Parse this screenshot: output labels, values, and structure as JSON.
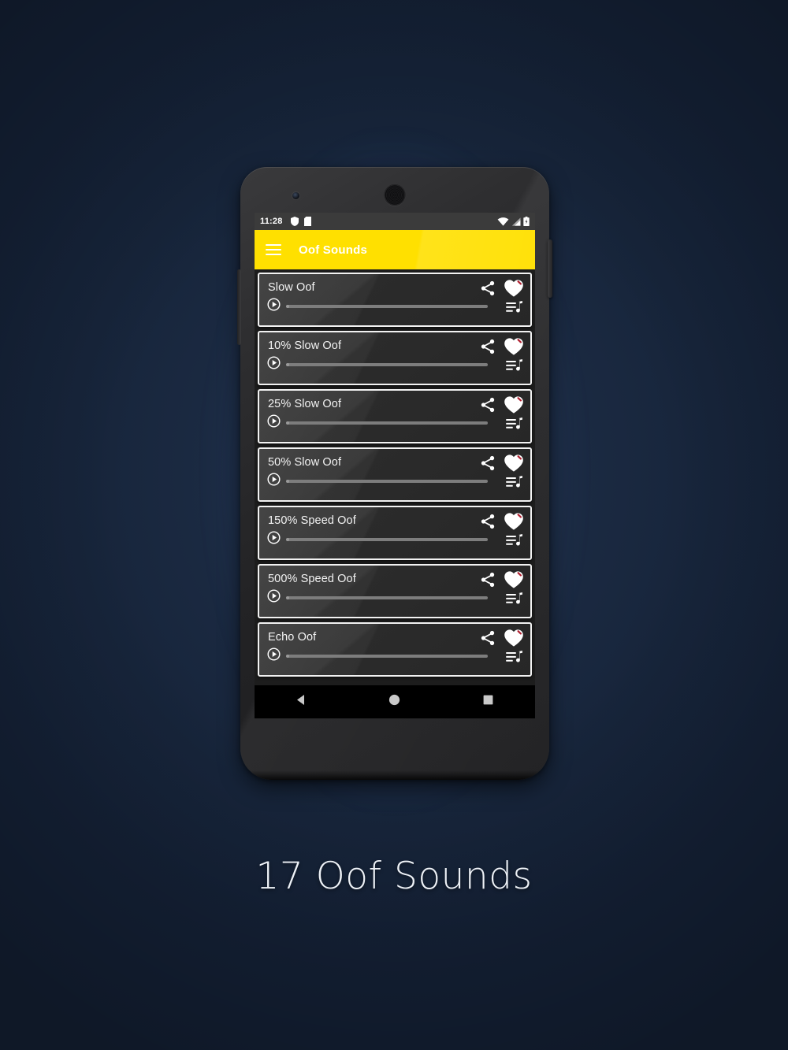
{
  "caption": "17 Oof Sounds",
  "phone": {
    "status_bar": {
      "time": "11:28",
      "left_icons": [
        "shield-icon",
        "sim-card-icon"
      ],
      "right_icons": [
        "wifi-icon",
        "cellular-signal-icon",
        "battery-icon"
      ]
    },
    "app_bar": {
      "menu_icon": "hamburger-menu-icon",
      "title": "Oof Sounds"
    },
    "nav_bar": {
      "back": "back-triangle-icon",
      "home": "home-circle-icon",
      "recents": "recents-square-icon"
    }
  },
  "sound_list": {
    "row_icons": {
      "share": "share-icon",
      "favorite": "heart-icon",
      "play": "play-circle-icon",
      "queue": "queue-music-icon"
    },
    "items": [
      {
        "title": "Slow Oof",
        "progress": 0
      },
      {
        "title": "10% Slow Oof",
        "progress": 0
      },
      {
        "title": "25% Slow Oof",
        "progress": 0
      },
      {
        "title": "50% Slow Oof",
        "progress": 0
      },
      {
        "title": "150% Speed Oof",
        "progress": 0
      },
      {
        "title": "500% Speed Oof",
        "progress": 0
      },
      {
        "title": "Echo Oof",
        "progress": 0
      }
    ]
  },
  "colors": {
    "accent": "#ffe000",
    "page_background": "#1b2a42",
    "card_background": "#2f2f2f",
    "card_border": "#f2f2f2",
    "screen_background": "#1d1d1d",
    "status_bar": "#3b3b3b",
    "nav_bar": "#000000",
    "heart_mark": "#b02030"
  }
}
